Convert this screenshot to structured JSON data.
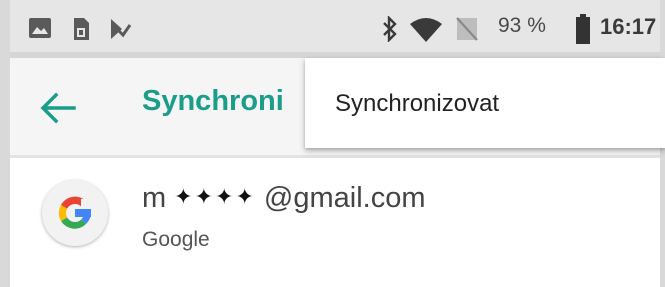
{
  "status_bar": {
    "battery_percent": "93 %",
    "time": "16:17",
    "left_icons": [
      "image-icon",
      "sim-card-icon",
      "download-check-icon"
    ],
    "right_icons": [
      "bluetooth-icon",
      "wifi-icon",
      "no-signal-icon",
      "battery-icon"
    ]
  },
  "toolbar": {
    "title": "Synchroni"
  },
  "menu": {
    "items": [
      {
        "label": "Synchronizovat"
      }
    ]
  },
  "account": {
    "email_prefix": "m",
    "email_masked": "✦✦✦✦",
    "email_suffix": "@gmail.com",
    "provider": "Google"
  }
}
